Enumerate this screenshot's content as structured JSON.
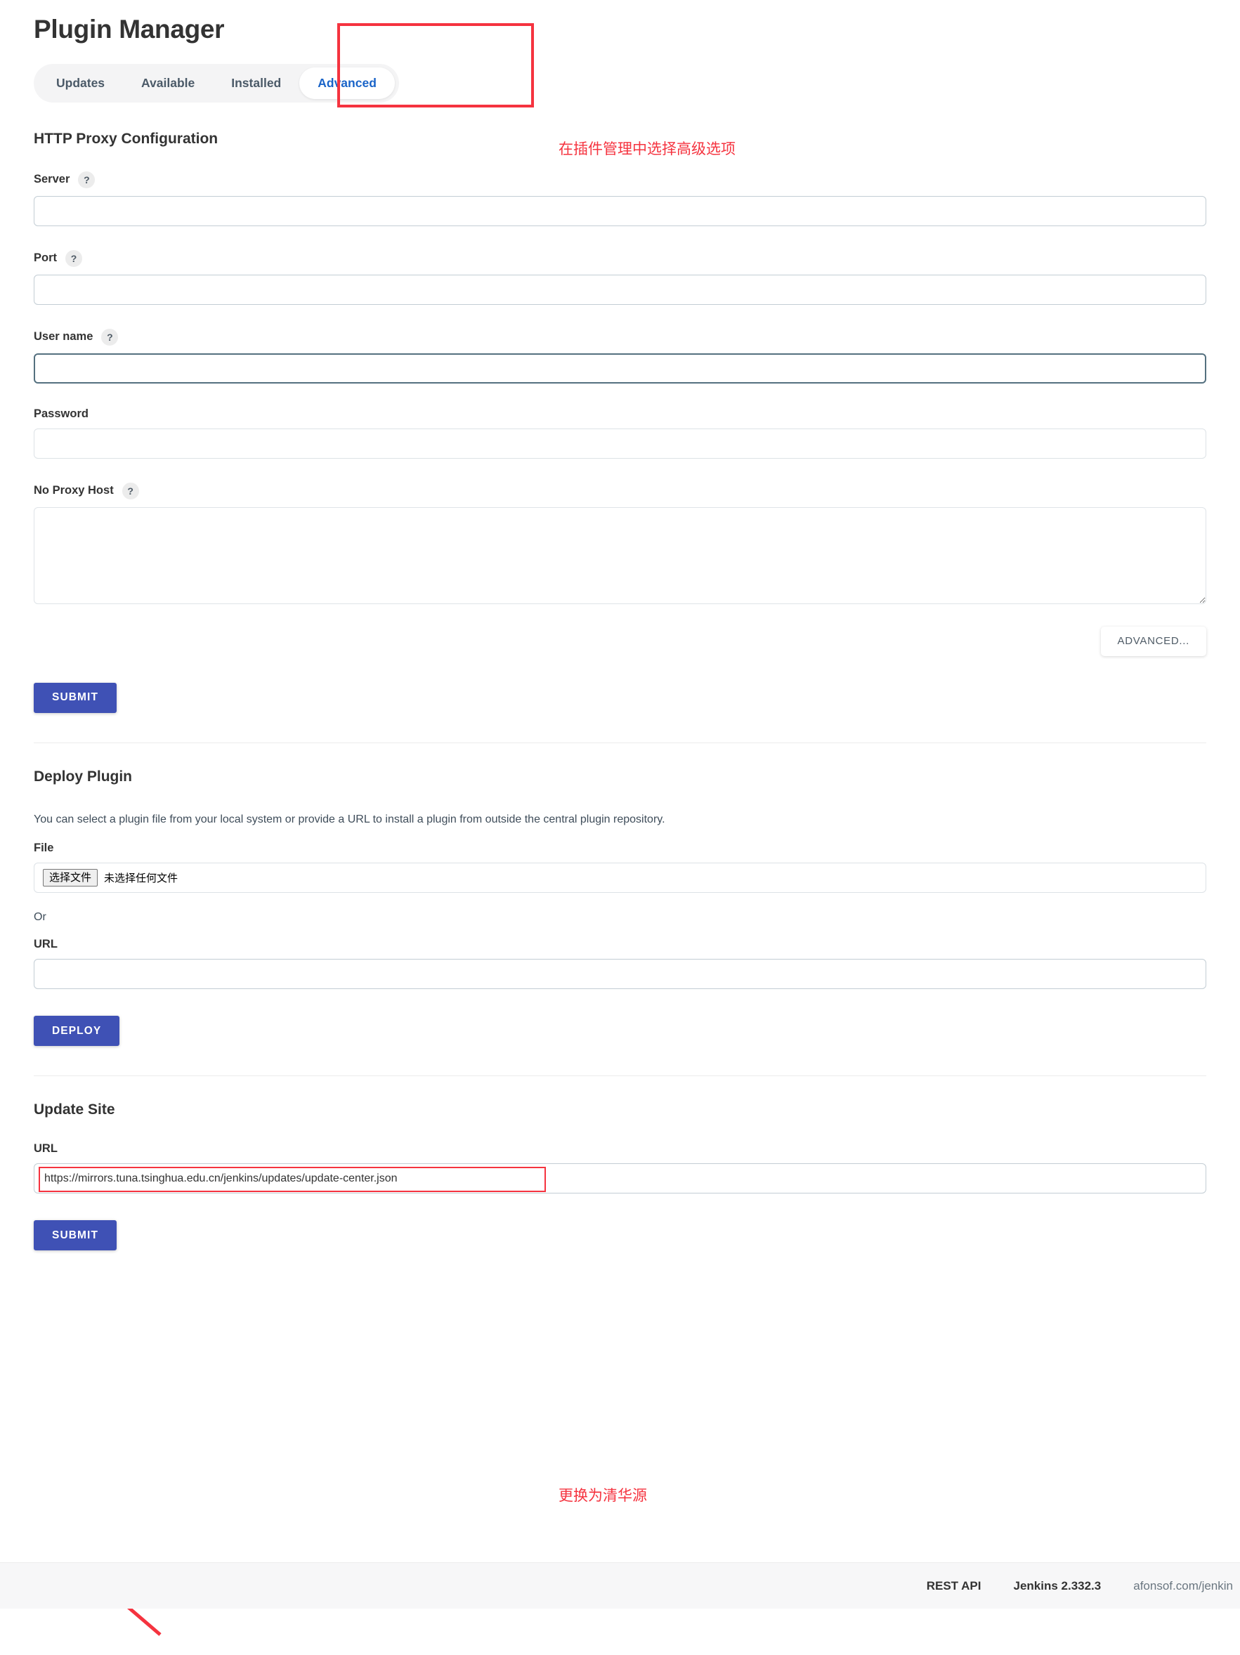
{
  "header": {
    "title": "Plugin Manager"
  },
  "tabs": [
    {
      "label": "Updates",
      "active": false
    },
    {
      "label": "Available",
      "active": false
    },
    {
      "label": "Installed",
      "active": false
    },
    {
      "label": "Advanced",
      "active": true
    }
  ],
  "annotations": {
    "advanced_tab": "在插件管理中选择高级选项",
    "update_site_url": "更换为清华源",
    "highlight_color": "#f5333f"
  },
  "proxy": {
    "section_title": "HTTP Proxy Configuration",
    "help_glyph": "?",
    "fields": [
      {
        "label": "Server",
        "has_help": true,
        "value": "",
        "placeholder": ""
      },
      {
        "label": "Port",
        "has_help": true,
        "value": "",
        "placeholder": ""
      },
      {
        "label": "User name",
        "has_help": true,
        "value": "",
        "placeholder": ""
      },
      {
        "label": "Password",
        "has_help": false,
        "value": "",
        "placeholder": ""
      },
      {
        "label": "No Proxy Host",
        "has_help": true,
        "value": "",
        "placeholder": ""
      }
    ],
    "advanced_button": "ADVANCED...",
    "submit_button": "SUBMIT"
  },
  "deploy": {
    "section_title": "Deploy Plugin",
    "description": "You can select a plugin file from your local system or provide a URL to install a plugin from outside the central plugin repository.",
    "file_label": "File",
    "file_choose_button": "选择文件",
    "file_status": "未选择任何文件",
    "or_label": "Or",
    "url_label": "URL",
    "url_value": "",
    "deploy_button": "DEPLOY"
  },
  "update_site": {
    "section_title": "Update Site",
    "url_label": "URL",
    "url_value": "https://mirrors.tuna.tsinghua.edu.cn/jenkins/updates/update-center.json",
    "submit_button": "SUBMIT"
  },
  "footer": {
    "rest_api": "REST API",
    "version": "Jenkins 2.332.3",
    "note": "afonsof.com/jenkin"
  },
  "colors": {
    "primary_button": "#3f51b5",
    "active_tab_text": "#1a64c8",
    "annotation_red": "#f5333f"
  }
}
